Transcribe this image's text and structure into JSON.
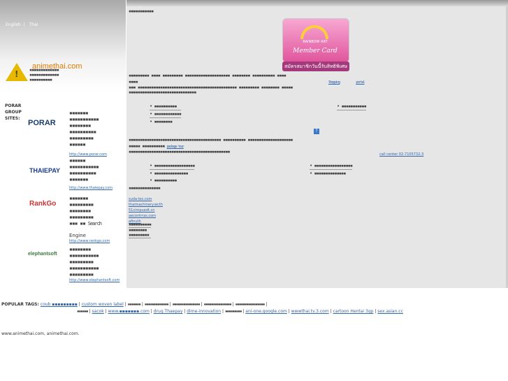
{
  "lang": {
    "english": "English",
    "thai": "Thai"
  },
  "brand": "animethai.com",
  "card": {
    "brand": "RAINBOW ART",
    "title": "Member Card",
    "caption": "สมัครสมาชิกวันนี้รับสิทธิพิเศษ"
  },
  "main": {
    "heading": "▪▪▪▪▪▪▪▪▪▪▪",
    "para1_l1": "▪▪▪▪▪▪▪▪▪ ▪▪▪▪ ▪▪▪▪▪▪▪▪▪ ▪▪▪▪▪▪▪▪▪▪▪▪▪▪▪▪▪▪▪▪ ▪▪▪▪▪▪▪▪ ▪▪▪▪▪▪▪▪▪▪ ▪▪▪▪",
    "para1_l2_pre": "▪▪▪▪",
    "para1_link": "Shopping",
    "para1_link2": "portal",
    "para1_l3": "▪▪▪ ▪▪▪▪▪▪▪▪▪▪▪▪▪▪▪▪▪▪▪▪▪▪▪▪▪▪▪▪▪▪▪▪▪▪▪▪▪▪▪▪▪▪▪▪ ▪▪▪▪▪▪▪▪▪ ▪▪▪▪▪▪▪▪ ▪▪▪▪▪",
    "para1_l4": "▪▪▪▪▪▪▪▪▪▪▪▪▪▪▪▪▪▪▪▪▪▪▪▪▪▪▪▪▪▪",
    "bullets1": [
      "▪▪▪▪▪▪▪▪▪▪",
      "▪▪▪▪▪▪▪▪▪▪▪▪",
      "▪▪▪▪▪▪▪▪"
    ],
    "bullets1b": [
      "▪▪▪▪▪▪▪▪▪▪▪"
    ],
    "para2_l1": "▪▪▪▪▪▪▪▪▪▪▪▪▪▪▪▪▪▪▪▪▪▪▪▪▪▪▪▪▪▪▪▪▪▪▪▪▪▪▪▪▪ ▪▪▪▪▪▪▪▪▪▪ ▪▪▪▪▪▪▪▪▪▪▪▪▪▪▪▪▪▪▪▪",
    "para2_l2": "▪▪▪▪▪ ▪▪▪▪▪▪▪▪▪▪",
    "para2_link": "package tour",
    "para2_l3": "▪▪▪▪▪▪▪▪▪▪▪▪▪▪▪▪▪▪▪▪▪▪▪▪▪▪▪▪▪▪▪▪▪▪▪▪▪▪▪▪▪▪▪▪▪",
    "para2_call": "call center 02-7105732-3",
    "bullets2": [
      "▪▪▪▪▪▪▪▪▪▪▪▪▪▪▪▪▪▪",
      "▪▪▪▪▪▪▪▪▪▪▪▪▪▪▪",
      "▪▪▪▪▪▪▪▪▪▪"
    ],
    "bullets2b": [
      "▪▪▪▪▪▪▪▪▪▪▪▪▪▪▪▪▪",
      "▪▪▪▪▪▪▪▪▪▪▪▪▪▪"
    ],
    "para3": "▪▪▪▪▪▪▪▪▪▪▪▪▪▪",
    "sidelinks": [
      "suda-lex.com",
      "thaimachinery.wcth",
      "51cimpuedt.cn",
      "aecontrras.com",
      "afinuth"
    ],
    "sidetxt": [
      "▪▪▪▪▪▪▪▪▪▪",
      "▪▪▪▪▪▪▪▪",
      "▪▪▪▪▪▪▪▪▪"
    ]
  },
  "left": {
    "title_l1": "▪▪▪▪▪▪▪▪▪▪▪▪▪",
    "title_l2": "▪▪▪▪▪▪▪▪▪▪▪▪▪",
    "title_l3": "▪▪▪▪▪▪▪▪▪▪",
    "sites_label": [
      "PORAR",
      "GROUP",
      "SITES:"
    ],
    "sites": [
      {
        "logo": "PORAR",
        "desc": [
          "▪▪▪▪▪▪▪",
          "▪▪▪▪▪▪▪▪▪▪▪",
          "▪▪▪▪▪▪▪▪",
          "▪▪▪▪▪▪▪▪▪▪",
          "▪▪▪▪▪▪▪▪▪",
          "▪▪▪▪▪▪"
        ],
        "url": "http://www.porar.com"
      },
      {
        "logo": "THAIEPAY",
        "desc": [
          "▪▪▪▪▪▪",
          "▪▪▪▪▪▪▪▪▪▪▪",
          "▪▪▪▪▪▪▪▪▪▪",
          "▪▪▪▪▪▪▪"
        ],
        "url": "http://www.thaiepay.com"
      },
      {
        "logo": "RankGo",
        "desc": [
          "▪▪▪▪▪▪▪",
          "▪▪▪▪▪▪▪▪▪",
          "▪▪▪▪▪▪▪▪",
          "▪▪▪▪▪▪▪▪▪",
          "▪▪▪ ▪▪"
        ],
        "search": "Search",
        "engine": "Engine",
        "url": "http://www.rankgo.com"
      },
      {
        "logo": "elephantsoft",
        "desc": [
          "▪▪▪▪▪▪▪▪",
          "▪▪▪▪▪▪▪▪▪▪▪",
          "▪▪▪▪▪▪▪▪▪",
          "▪▪▪▪▪▪▪▪▪▪▪",
          "▪▪▪▪▪▪▪▪▪"
        ],
        "url": "http://www.elephantsoft.com"
      }
    ]
  },
  "footer": {
    "tags_title": "POPULAR TAGS:",
    "tags_row1": [
      "coub ▪▪▪▪▪▪▪▪▪",
      "custom woven label",
      "▪▪▪▪▪▪▪",
      "▪▪▪▪▪▪▪▪▪▪▪▪▪",
      "▪▪▪▪▪▪▪▪▪▪▪▪▪▪▪",
      "▪▪▪▪▪▪▪▪▪▪▪▪▪▪▪",
      "▪▪▪▪▪▪▪▪▪▪▪▪▪▪▪▪",
      "▪▪▪▪▪▪▪▪▪▪▪▪▪▪▪▪"
    ],
    "tags_row2": [
      "▪▪▪▪▪▪",
      "sacok",
      "www.▪▪▪▪▪▪▪.com",
      "drug.Thaepay",
      "dime-innovation",
      "▪▪▪▪▪▪▪▪▪",
      "ani-one.google.com",
      "wwwthai.tv.3.com",
      "cartoon Hentai 3gp",
      "sex.asian.cc"
    ],
    "copyright": "www.animethai.com, animethai.com."
  }
}
